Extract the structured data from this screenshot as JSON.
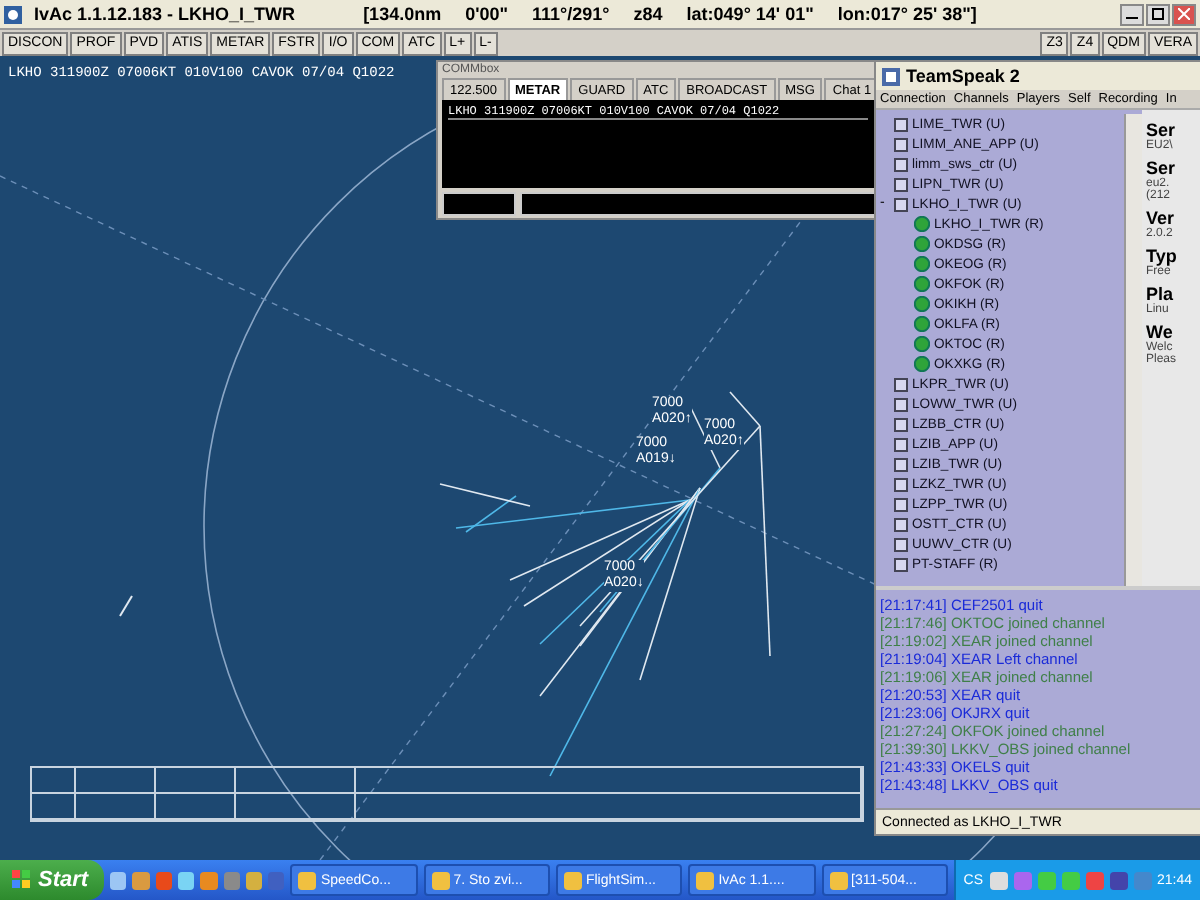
{
  "title_bar": {
    "title": "IvAc 1.1.12.183  - LKHO_I_TWR",
    "readouts": [
      "[134.0nm",
      "0'00\"",
      "111°/291°",
      "z84",
      "lat:049° 14' 01\"",
      "lon:017° 25' 38\"]"
    ]
  },
  "toolbar": {
    "left": [
      "DISCON",
      "PROF",
      "PVD",
      "ATIS",
      "METAR",
      "FSTR",
      "I/O",
      "COM",
      "ATC",
      "L+",
      "L-"
    ],
    "right": [
      "Z3",
      "Z4",
      "QDM",
      "VERA"
    ]
  },
  "metar_line": "LKHO 311900Z 07006KT 010V100 CAVOK 07/04 Q1022",
  "radar_tags": [
    {
      "lines": [
        "7000",
        "A020↑"
      ]
    },
    {
      "lines": [
        "7000",
        "A020↑"
      ]
    },
    {
      "lines": [
        "7000",
        "A019↓"
      ]
    },
    {
      "lines": [
        "7000",
        "A020↓"
      ]
    }
  ],
  "comm_box": {
    "title": "COMMbox",
    "tabs": [
      {
        "label": "122.500",
        "selected": false
      },
      {
        "label": "METAR",
        "selected": true
      },
      {
        "label": "GUARD",
        "selected": false
      },
      {
        "label": "ATC",
        "selected": false
      },
      {
        "label": "BROADCAST",
        "selected": false
      },
      {
        "label": "MSG",
        "selected": false
      },
      {
        "label": "Chat 1",
        "selected": false
      }
    ],
    "lines": [
      "LKHO 311900Z 07006KT 010V100 CAVOK 07/04 Q1022"
    ]
  },
  "teamspeak": {
    "title": "TeamSpeak 2",
    "menu": [
      "Connection",
      "Channels",
      "Players",
      "Self",
      "Recording",
      "In"
    ],
    "channels": [
      {
        "name": "LIME_TWR",
        "flag": "(U)"
      },
      {
        "name": "LIMM_ANE_APP",
        "flag": "(U)"
      },
      {
        "name": "limm_sws_ctr",
        "flag": "(U)"
      },
      {
        "name": "LIPN_TWR",
        "flag": "(U)"
      },
      {
        "name": "LKHO_I_TWR",
        "flag": "(U)",
        "toggle": "-",
        "children": [
          {
            "name": "LKHO_I_TWR",
            "flag": "(R)"
          },
          {
            "name": "OKDSG",
            "flag": "(R)"
          },
          {
            "name": "OKEOG",
            "flag": "(R)"
          },
          {
            "name": "OKFOK",
            "flag": "(R)"
          },
          {
            "name": "OKIKH",
            "flag": "(R)"
          },
          {
            "name": "OKLFA",
            "flag": "(R)"
          },
          {
            "name": "OKTOC",
            "flag": "(R)"
          },
          {
            "name": "OKXKG",
            "flag": "(R)"
          }
        ]
      },
      {
        "name": "LKPR_TWR",
        "flag": "(U)"
      },
      {
        "name": "LOWW_TWR",
        "flag": "(U)"
      },
      {
        "name": "LZBB_CTR",
        "flag": "(U)"
      },
      {
        "name": "LZIB_APP",
        "flag": "(U)"
      },
      {
        "name": "LZIB_TWR",
        "flag": "(U)"
      },
      {
        "name": "LZKZ_TWR",
        "flag": "(U)"
      },
      {
        "name": "LZPP_TWR",
        "flag": "(U)"
      },
      {
        "name": "OSTT_CTR",
        "flag": "(U)"
      },
      {
        "name": "UUWV_CTR",
        "flag": "(U)"
      },
      {
        "name": "PT-STAFF",
        "flag": "(R)"
      }
    ],
    "info": [
      {
        "heading": "Ser",
        "lines": [
          "EU2\\"
        ]
      },
      {
        "heading": "Ser",
        "lines": [
          "eu2.",
          "(212"
        ]
      },
      {
        "heading": "Ver",
        "lines": [
          "2.0.2"
        ]
      },
      {
        "heading": "Typ",
        "lines": [
          "Free"
        ]
      },
      {
        "heading": "Pla",
        "lines": [
          "Linu"
        ]
      },
      {
        "heading": "We",
        "lines": [
          "Welc",
          "Pleas"
        ]
      }
    ],
    "log": [
      {
        "time": "[21:17:41]",
        "text": "CEF2501 quit",
        "kind": "quit"
      },
      {
        "time": "[21:17:46]",
        "text": "OKTOC joined channel",
        "kind": "joined"
      },
      {
        "time": "[21:19:02]",
        "text": "XEAR joined channel",
        "kind": "joined"
      },
      {
        "time": "[21:19:04]",
        "text": "XEAR Left channel",
        "kind": "left"
      },
      {
        "time": "[21:19:06]",
        "text": "XEAR joined channel",
        "kind": "joined"
      },
      {
        "time": "[21:20:53]",
        "text": "XEAR quit",
        "kind": "quit"
      },
      {
        "time": "[21:23:06]",
        "text": "OKJRX quit",
        "kind": "quit"
      },
      {
        "time": "[21:27:24]",
        "text": "OKFOK joined channel",
        "kind": "joined"
      },
      {
        "time": "[21:39:30]",
        "text": "LKKV_OBS joined channel",
        "kind": "joined"
      },
      {
        "time": "[21:43:33]",
        "text": "OKELS quit",
        "kind": "quit"
      },
      {
        "time": "[21:43:48]",
        "text": "LKKV_OBS quit",
        "kind": "quit"
      }
    ],
    "status": "Connected as LKHO_I_TWR"
  },
  "taskbar": {
    "start": "Start",
    "tasks": [
      "SpeedCo...",
      "7. Sto zvi...",
      "FlightSim...",
      "IvAc 1.1....",
      "[311-504..."
    ],
    "language": "CS",
    "clock": "21:44"
  }
}
